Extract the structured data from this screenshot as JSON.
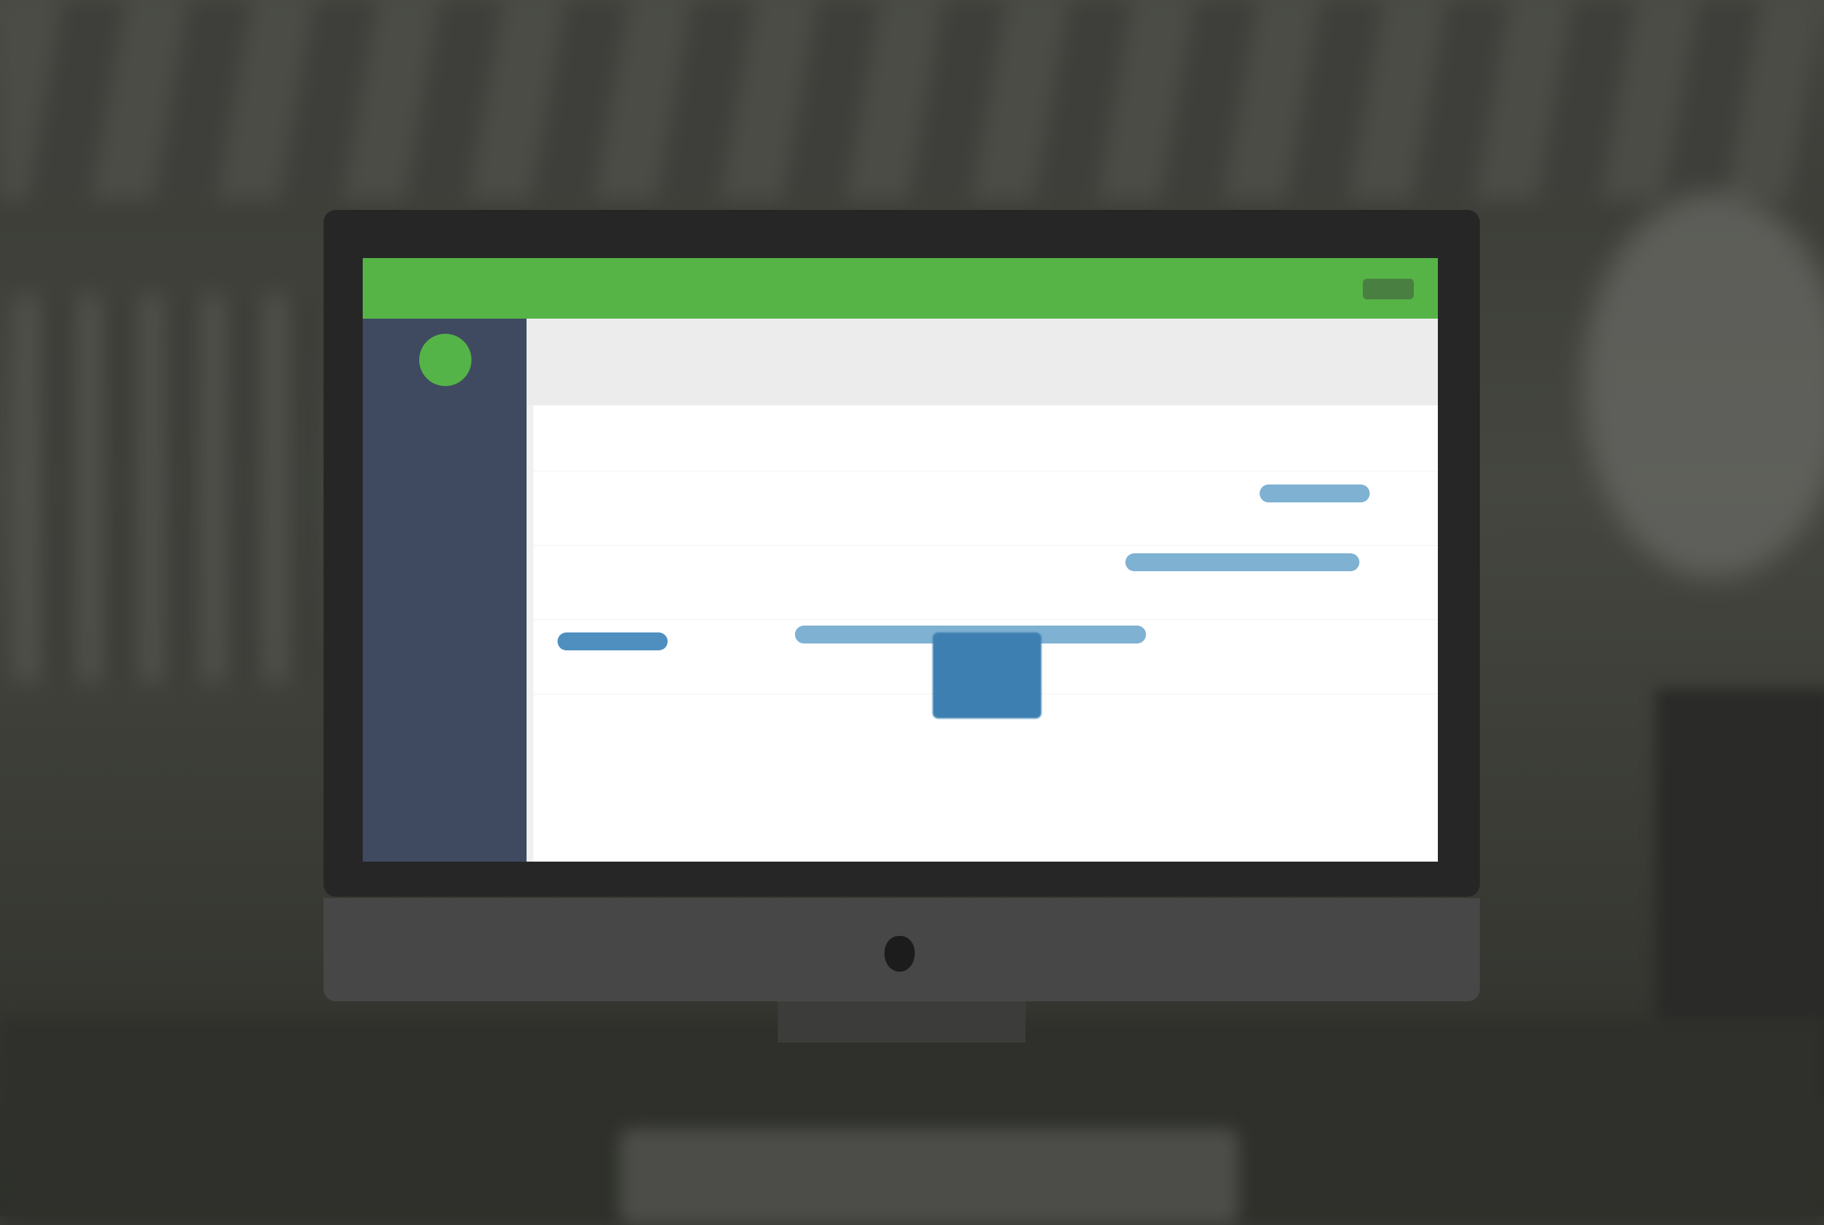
{
  "app": {
    "title": "",
    "user_chip": "",
    "accent_color": "#56b447",
    "sidebar_color": "#3f4a60"
  },
  "sidebar": {
    "items": [
      {
        "label": ""
      },
      {
        "label": ""
      },
      {
        "label": ""
      },
      {
        "label": ""
      },
      {
        "label": ""
      },
      {
        "label": ""
      },
      {
        "label": ""
      },
      {
        "label": ""
      }
    ]
  },
  "page": {
    "title": ""
  },
  "calendar": {
    "prev_label": "",
    "month_label": "",
    "next_label": "",
    "events": [
      {
        "label": ""
      },
      {
        "label": ""
      },
      {
        "label": ""
      },
      {
        "label": ""
      },
      {
        "label": ""
      }
    ]
  }
}
